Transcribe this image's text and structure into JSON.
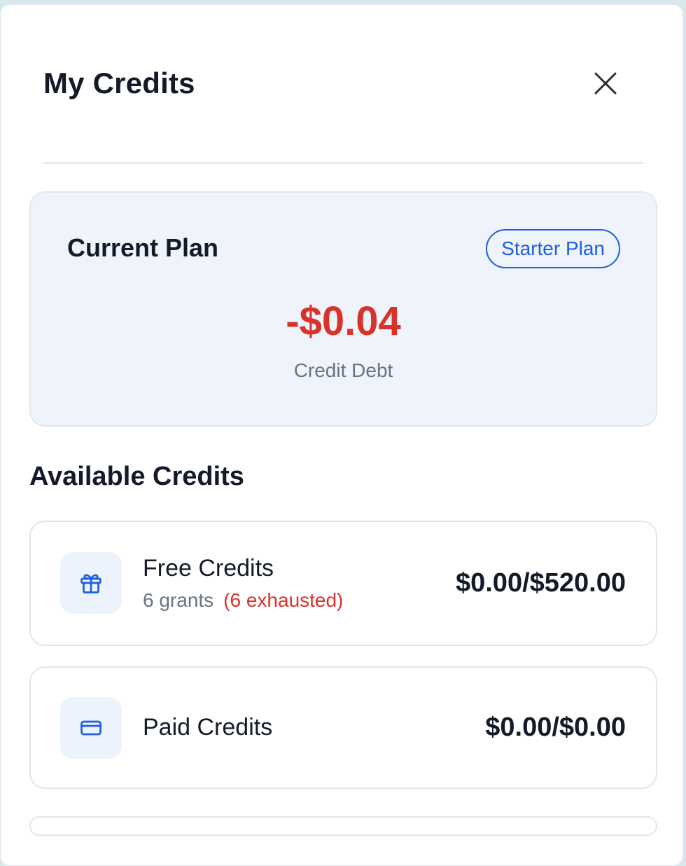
{
  "header": {
    "title": "My Credits"
  },
  "current_plan": {
    "title": "Current Plan",
    "plan_badge": "Starter Plan",
    "amount": "-$0.04",
    "amount_label": "Credit Debt"
  },
  "available_credits": {
    "title": "Available Credits",
    "items": [
      {
        "label": "Free Credits",
        "icon": "gift-icon",
        "grants": "6 grants",
        "exhausted": "(6 exhausted)",
        "value": "$0.00/$520.00"
      },
      {
        "label": "Paid Credits",
        "icon": "credit-card-icon",
        "value": "$0.00/$0.00"
      }
    ]
  },
  "colors": {
    "accent": "#1d5fe0",
    "debt": "#d9322b",
    "plan_card_bg": "#eef3fc",
    "icon_bg": "#edf3fd"
  }
}
